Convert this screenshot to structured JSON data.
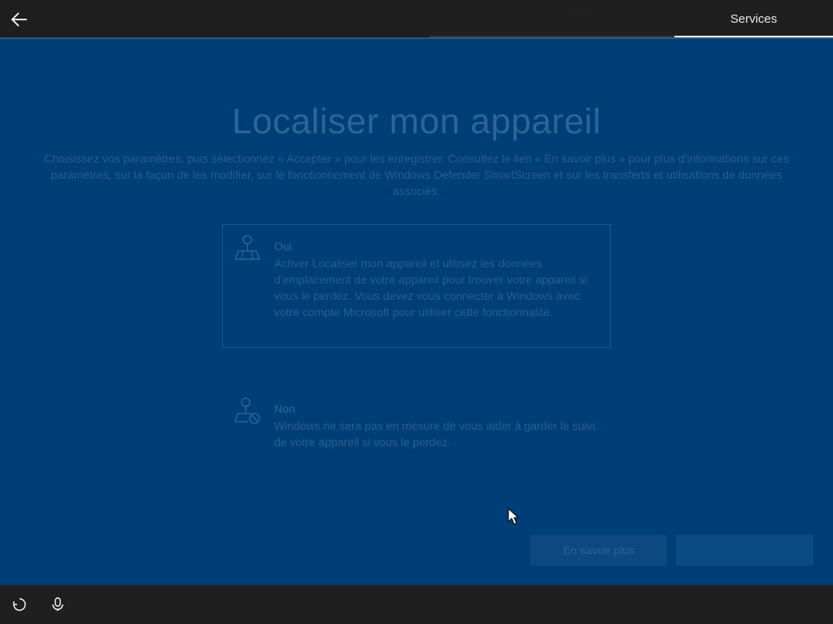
{
  "window": {
    "section_title": "Services",
    "crumb_text": "· · · · · · ·"
  },
  "page": {
    "title": "Localiser mon appareil",
    "description": "Choisissez vos paramètres, puis sélectionnez « Accepter » pour les enregistrer. Consultez le lien « En savoir plus » pour plus d'informations sur ces paramètres, sur la façon de les modifier, sur le fonctionnement de Windows Defender SmartScreen et sur les transferts et utilisations de données associés."
  },
  "options": [
    {
      "title": "Oui",
      "description": "Activer Localiser mon appareil et utilisez les données d'emplacement de votre appareil pour trouver votre appareil si vous le perdez. Vous devez vous connecter à Windows avec votre compte Microsoft pour utiliser cette fonctionnalité.",
      "icon": "location-map-icon"
    },
    {
      "title": "Non",
      "description": "Windows ne sera pas en mesure de vous aider à garder le suivi de votre appareil si vous le perdez.",
      "icon": "location-off-icon"
    }
  ],
  "buttons": {
    "learn_more": "En savoir plus",
    "accept": ""
  },
  "colors": {
    "background": "#003e77",
    "topbar": "#1f1f1f",
    "accent": "#ffffff"
  },
  "icons": {
    "back": "back-arrow-icon",
    "accessibility": "accessibility-icon",
    "microphone": "microphone-icon",
    "cursor": "mouse-cursor-icon"
  }
}
